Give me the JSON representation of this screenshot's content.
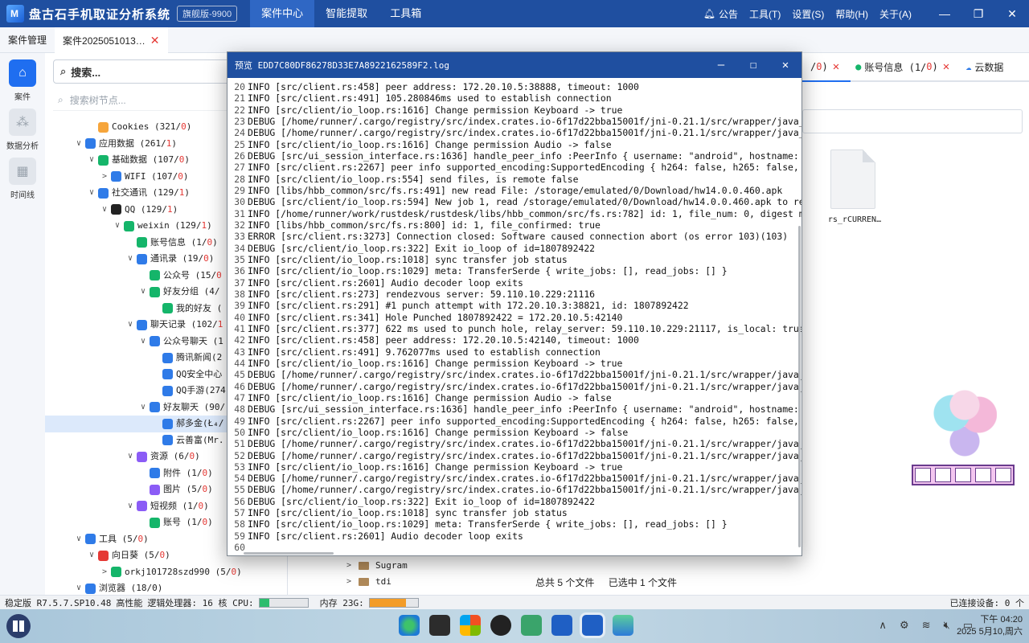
{
  "app": {
    "title": "盘古石手机取证分析系统",
    "edition": "旗舰版-9900",
    "nav": [
      "案件中心",
      "智能提取",
      "工具箱"
    ],
    "right_menu": [
      "公告",
      "工具(T)",
      "设置(S)",
      "帮助(H)",
      "关于(A)"
    ],
    "window_controls": [
      "—",
      "❐",
      "✕"
    ]
  },
  "tabs": [
    {
      "label": "案件管理"
    },
    {
      "label": "案件2025051013…"
    }
  ],
  "sidebar": [
    {
      "label": "案件",
      "icon": "home-icon"
    },
    {
      "label": "数据分析",
      "icon": "analysis-icon"
    },
    {
      "label": "时间线",
      "icon": "timeline-icon"
    }
  ],
  "search": {
    "placeholder": "搜索...",
    "tree_placeholder": "搜索树节点..."
  },
  "tree": [
    {
      "label": "Cookies (321/",
      "red": "0",
      "end": ")",
      "indent": 52,
      "arrow": "",
      "color": "#f6a53b"
    },
    {
      "label": "应用数据 (261/",
      "red": "1",
      "end": ")",
      "indent": 36,
      "arrow": "∨",
      "color": "#2f7be8"
    },
    {
      "label": "基础数据 (107/",
      "red": "0",
      "end": ")",
      "indent": 52,
      "arrow": "∨",
      "color": "#15b56a"
    },
    {
      "label": "WIFI (107/",
      "red": "0",
      "end": ")",
      "indent": 68,
      "arrow": ">",
      "color": "#2f7be8"
    },
    {
      "label": "社交通讯 (129/",
      "red": "1",
      "end": ")",
      "indent": 52,
      "arrow": "∨",
      "color": "#2f7be8"
    },
    {
      "label": "QQ (129/",
      "red": "1",
      "end": ")",
      "indent": 68,
      "arrow": "∨",
      "color": "#222"
    },
    {
      "label": "weixin (129/",
      "red": "1",
      "end": ")",
      "indent": 84,
      "arrow": "∨",
      "color": "#15b56a"
    },
    {
      "label": "账号信息 (1/",
      "red": "0",
      "end": ")",
      "indent": 100,
      "arrow": "",
      "color": "#15b56a"
    },
    {
      "label": "通讯录 (19/",
      "red": "0",
      "end": ")",
      "indent": 100,
      "arrow": "∨",
      "color": "#2f7be8"
    },
    {
      "label": "公众号 (15/",
      "red": "0",
      "end": "",
      "indent": 116,
      "arrow": "",
      "color": "#15b56a"
    },
    {
      "label": "好友分组 (4/",
      "red": "",
      "end": "",
      "indent": 116,
      "arrow": "∨",
      "color": "#15b56a"
    },
    {
      "label": "我的好友 (",
      "red": "",
      "end": "",
      "indent": 132,
      "arrow": "",
      "color": "#15b56a"
    },
    {
      "label": "聊天记录 (102/",
      "red": "1",
      "end": "",
      "indent": 100,
      "arrow": "∨",
      "color": "#2f7be8"
    },
    {
      "label": "公众号聊天 (1",
      "red": "",
      "end": "",
      "indent": 116,
      "arrow": "∨",
      "color": "#2f7be8"
    },
    {
      "label": "腾讯新闻(2",
      "red": "",
      "end": "",
      "indent": 132,
      "arrow": "",
      "color": "#2f7be8"
    },
    {
      "label": "QQ安全中心",
      "red": "",
      "end": "",
      "indent": 132,
      "arrow": "",
      "color": "#2f7be8"
    },
    {
      "label": "QQ手游(274",
      "red": "",
      "end": "",
      "indent": 132,
      "arrow": "",
      "color": "#2f7be8"
    },
    {
      "label": "好友聊天 (90/",
      "red": "",
      "end": "",
      "indent": 116,
      "arrow": "∨",
      "color": "#2f7be8"
    },
    {
      "label": "郝多金(Ł₄/",
      "red": "",
      "end": "",
      "indent": 132,
      "arrow": "",
      "color": "#2f7be8",
      "selected": true
    },
    {
      "label": "云善富(Mr.",
      "red": "",
      "end": "",
      "indent": 132,
      "arrow": "",
      "color": "#2f7be8"
    },
    {
      "label": "资源 (6/",
      "red": "0",
      "end": ")",
      "indent": 100,
      "arrow": "∨",
      "color": "#8b5cf6"
    },
    {
      "label": "附件 (1/",
      "red": "0",
      "end": ")",
      "indent": 116,
      "arrow": "",
      "color": "#2f7be8"
    },
    {
      "label": "图片 (5/",
      "red": "0",
      "end": ")",
      "indent": 116,
      "arrow": "",
      "color": "#8b5cf6"
    },
    {
      "label": "短视频 (1/",
      "red": "0",
      "end": ")",
      "indent": 100,
      "arrow": "∨",
      "color": "#8b5cf6"
    },
    {
      "label": "账号 (1/",
      "red": "0",
      "end": ")",
      "indent": 116,
      "arrow": "",
      "color": "#15b56a"
    },
    {
      "label": "工具 (5/",
      "red": "0",
      "end": ")",
      "indent": 36,
      "arrow": "∨",
      "color": "#2f7be8"
    },
    {
      "label": "向日葵 (5/",
      "red": "0",
      "end": ")",
      "indent": 52,
      "arrow": "∨",
      "color": "#e53935"
    },
    {
      "label": "orkj101728szd990 (5/",
      "red": "0",
      "end": ")",
      "indent": 68,
      "arrow": ">",
      "color": "#15b56a"
    },
    {
      "label": "浏览器 (18/0)",
      "red": "",
      "end": "",
      "indent": 36,
      "arrow": "∨",
      "color": "#2f7be8"
    }
  ],
  "right_tabs": [
    {
      "label": "/",
      "red": "0",
      "end": ")"
    },
    {
      "label": "账号信息 (1/",
      "red": "0",
      "end": ")"
    },
    {
      "label": "云数据",
      "red": "",
      "end": ""
    }
  ],
  "file": {
    "name": "rs_rCURREN…"
  },
  "lower_tree": [
    "Sugram",
    "tdi"
  ],
  "file_status": {
    "total": "总共 5 个文件",
    "selected": "已选中 1 个文件"
  },
  "statusbar": {
    "version": "稳定版 R7.5.7.SP10.48",
    "perf": "高性能",
    "cpu_label": "逻辑处理器: 16 核 CPU:",
    "cpu_fill": 0.2,
    "mem_label": "内存 23G:",
    "mem_fill": 0.75,
    "devices": "已连接设备: 0 个"
  },
  "taskbar": {
    "time": "下午 04:20",
    "date": "2025 5月10,周六"
  },
  "dialog": {
    "title": "预览 EDD7C80DF86278D33E7A8922162589F2.log",
    "lines": [
      {
        "n": "20",
        "t": "INFO [src/client.rs:458] peer address: 172.20.10.5:38888, timeout: 1000"
      },
      {
        "n": "21",
        "t": "INFO [src/client.rs:491] 105.280846ms used to establish connection"
      },
      {
        "n": "22",
        "t": "INFO [src/client/io_loop.rs:1616] Change permission Keyboard -> true"
      },
      {
        "n": "23",
        "t": "DEBUG [/home/runner/.cargo/registry/src/index.crates.io-6f17d22bba15001f/jni-0.21.1/src/wrapper/java_vm"
      },
      {
        "n": "24",
        "t": "DEBUG [/home/runner/.cargo/registry/src/index.crates.io-6f17d22bba15001f/jni-0.21.1/src/wrapper/java_vm"
      },
      {
        "n": "25",
        "t": "INFO [src/client/io_loop.rs:1616] Change permission Audio -> false"
      },
      {
        "n": "26",
        "t": "DEBUG [src/ui_session_interface.rs:1636] handle_peer_info :PeerInfo { username: \"android\", hostname: \"A"
      },
      {
        "n": "27",
        "t": "INFO [src/client.rs:2267] peer info supported_encoding:SupportedEncoding { h264: false, h265: false, vp"
      },
      {
        "n": "28",
        "t": "INFO [src/client/io_loop.rs:554] send files, is remote false"
      },
      {
        "n": "29",
        "t": "INFO [libs/hbb_common/src/fs.rs:491] new read File: /storage/emulated/0/Download/hw14.0.0.460.apk"
      },
      {
        "n": "30",
        "t": "DEBUG [src/client/io_loop.rs:594] New job 1, read /storage/emulated/0/Download/hw14.0.0.460.apk to remo"
      },
      {
        "n": "31",
        "t": "INFO [/home/runner/work/rustdesk/rustdesk/libs/hbb_common/src/fs.rs:782] id: 1, file_num: 0, digest mes"
      },
      {
        "n": "32",
        "t": "INFO [libs/hbb_common/src/fs.rs:800] id: 1, file_confirmed: true"
      },
      {
        "n": "33",
        "t": "ERROR [src/client.rs:3273] Connection closed: Software caused connection abort (os error 103)(103)"
      },
      {
        "n": "34",
        "t": "DEBUG [src/client/io_loop.rs:322] Exit io_loop of id=1807892422"
      },
      {
        "n": "35",
        "t": "INFO [src/client/io_loop.rs:1018] sync transfer job status"
      },
      {
        "n": "36",
        "t": "INFO [src/client/io_loop.rs:1029] meta: TransferSerde { write_jobs: [], read_jobs: [] }"
      },
      {
        "n": "37",
        "t": "INFO [src/client.rs:2601] Audio decoder loop exits"
      },
      {
        "n": "38",
        "t": "INFO [src/client.rs:273] rendezvous server: 59.110.10.229:21116"
      },
      {
        "n": "39",
        "t": "INFO [src/client.rs:291] #1 punch attempt with 172.20.10.3:38821, id: 1807892422"
      },
      {
        "n": "40",
        "t": "INFO [src/client.rs:341] Hole Punched 1807892422 = 172.20.10.5:42140"
      },
      {
        "n": "41",
        "t": "INFO [src/client.rs:377] 622 ms used to punch hole, relay_server: 59.110.10.229:21117, is_local: true"
      },
      {
        "n": "42",
        "t": "INFO [src/client.rs:458] peer address: 172.20.10.5:42140, timeout: 1000"
      },
      {
        "n": "43",
        "t": "INFO [src/client.rs:491] 9.762077ms used to establish connection"
      },
      {
        "n": "44",
        "t": "INFO [src/client/io_loop.rs:1616] Change permission Keyboard -> true"
      },
      {
        "n": "45",
        "t": "DEBUG [/home/runner/.cargo/registry/src/index.crates.io-6f17d22bba15001f/jni-0.21.1/src/wrapper/java_vm"
      },
      {
        "n": "46",
        "t": "DEBUG [/home/runner/.cargo/registry/src/index.crates.io-6f17d22bba15001f/jni-0.21.1/src/wrapper/java_vm"
      },
      {
        "n": "47",
        "t": "INFO [src/client/io_loop.rs:1616] Change permission Audio -> false"
      },
      {
        "n": "48",
        "t": "DEBUG [src/ui_session_interface.rs:1636] handle_peer_info :PeerInfo { username: \"android\", hostname: \"A"
      },
      {
        "n": "49",
        "t": "INFO [src/client.rs:2267] peer info supported_encoding:SupportedEncoding { h264: false, h265: false, vp"
      },
      {
        "n": "50",
        "t": "INFO [src/client/io_loop.rs:1616] Change permission Keyboard -> false"
      },
      {
        "n": "51",
        "t": "DEBUG [/home/runner/.cargo/registry/src/index.crates.io-6f17d22bba15001f/jni-0.21.1/src/wrapper/java_vm"
      },
      {
        "n": "52",
        "t": "DEBUG [/home/runner/.cargo/registry/src/index.crates.io-6f17d22bba15001f/jni-0.21.1/src/wrapper/java_vm"
      },
      {
        "n": "53",
        "t": "INFO [src/client/io_loop.rs:1616] Change permission Keyboard -> true"
      },
      {
        "n": "54",
        "t": "DEBUG [/home/runner/.cargo/registry/src/index.crates.io-6f17d22bba15001f/jni-0.21.1/src/wrapper/java_vm"
      },
      {
        "n": "55",
        "t": "DEBUG [/home/runner/.cargo/registry/src/index.crates.io-6f17d22bba15001f/jni-0.21.1/src/wrapper/java_vm"
      },
      {
        "n": "56",
        "t": "DEBUG [src/client/io_loop.rs:322] Exit io_loop of id=1807892422"
      },
      {
        "n": "57",
        "t": "INFO [src/client/io_loop.rs:1018] sync transfer job status"
      },
      {
        "n": "58",
        "t": "INFO [src/client/io_loop.rs:1029] meta: TransferSerde { write_jobs: [], read_jobs: [] }"
      },
      {
        "n": "59",
        "t": "INFO [src/client.rs:2601] Audio decoder loop exits"
      },
      {
        "n": "60",
        "t": ""
      }
    ]
  }
}
